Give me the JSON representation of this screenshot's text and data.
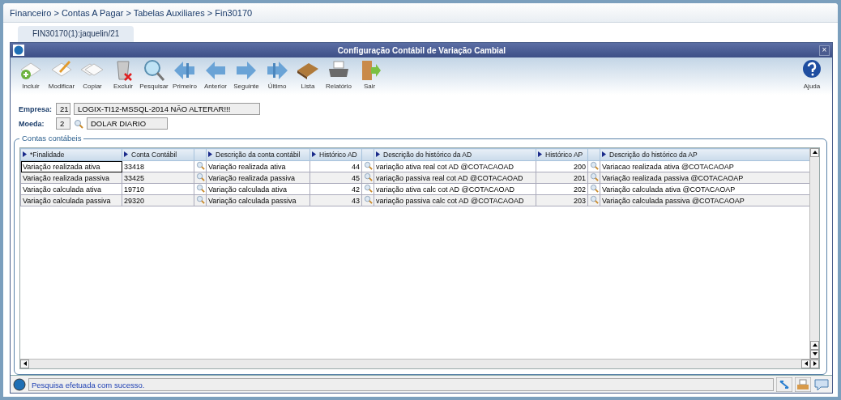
{
  "breadcrumb": "Financeiro > Contas A Pagar > Tabelas Auxiliares > Fin30170",
  "tabs": [
    {
      "label": "FIN30170(1):jaquelin/21",
      "selected": true
    }
  ],
  "window": {
    "title": "Configuração Contábil de Variação Cambial",
    "close": "×"
  },
  "toolbar": [
    {
      "kind": "add",
      "label": "Incluir"
    },
    {
      "kind": "edit",
      "label": "Modificar"
    },
    {
      "kind": "copy",
      "label": "Copiar"
    },
    {
      "kind": "delete",
      "label": "Excluir"
    },
    {
      "kind": "search",
      "label": "Pesquisar"
    },
    {
      "kind": "first",
      "label": "Primeiro"
    },
    {
      "kind": "prev",
      "label": "Anterior"
    },
    {
      "kind": "next",
      "label": "Seguinte"
    },
    {
      "kind": "last",
      "label": "Último"
    },
    {
      "kind": "book",
      "label": "Lista"
    },
    {
      "kind": "printer",
      "label": "Relatório"
    },
    {
      "kind": "exit",
      "label": "Sair"
    }
  ],
  "help": {
    "label": "Ajuda"
  },
  "form": {
    "empresa": {
      "label": "Empresa:",
      "code": "21",
      "name": "LOGIX-TI12-MSSQL-2014 NÃO ALTERAR!!!"
    },
    "moeda": {
      "label": "Moeda:",
      "code": "2",
      "name": "DOLAR DIARIO"
    }
  },
  "group": {
    "title": "Contas contábeis"
  },
  "table": {
    "columns": [
      {
        "kind": "text",
        "label": "*Finalidade"
      },
      {
        "kind": "text",
        "label": "Conta Contábil"
      },
      {
        "kind": "lookup"
      },
      {
        "kind": "text",
        "label": "Descrição da conta contábil"
      },
      {
        "kind": "num",
        "label": "Histórico AD"
      },
      {
        "kind": "lookup"
      },
      {
        "kind": "text",
        "label": "Descrição do histórico da AD"
      },
      {
        "kind": "num",
        "label": "Histórico AP"
      },
      {
        "kind": "lookup"
      },
      {
        "kind": "text",
        "label": "Descrição do histórico da AP"
      }
    ],
    "rows": [
      {
        "focused": true,
        "cells": [
          "Variação realizada ativa",
          "33418",
          "",
          "Variação realizada ativa",
          "44",
          "",
          "variação ativa real cot AD @COTACAOAD",
          "200",
          "",
          "Variacao realizada ativa @COTACAOAP"
        ]
      },
      {
        "focused": false,
        "cells": [
          "Variação realizada passiva",
          "33425",
          "",
          "Variação realizada passiva",
          "45",
          "",
          "variação passiva real cot AD @COTACAOAD",
          "201",
          "",
          "Variação realizada passiva @COTACAOAP"
        ]
      },
      {
        "focused": false,
        "cells": [
          "Variação calculada ativa",
          "19710",
          "",
          "Variação calculada ativa",
          "42",
          "",
          "variação ativa calc cot AD @COTACAOAD",
          "202",
          "",
          "Variação calculada ativa @COTACAOAP"
        ]
      },
      {
        "focused": false,
        "cells": [
          "Variação calculada passiva",
          "29320",
          "",
          "Variação calculada passiva",
          "43",
          "",
          "variação passiva calc cot AD @COTACAOAD",
          "203",
          "",
          "Variação calculada passiva @COTACAOAP"
        ]
      }
    ]
  },
  "status_bar": {
    "message": "Pesquisa efetuada com sucesso."
  }
}
